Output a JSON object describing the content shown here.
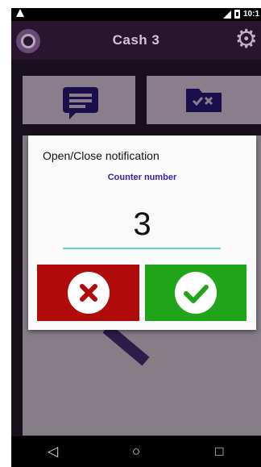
{
  "status_bar": {
    "time": "10:1",
    "left_icon": "alert-triangle-icon",
    "signal_icon": "signal-icon",
    "battery_icon": "battery-icon"
  },
  "header": {
    "title": "Cash 3",
    "logo_icon": "app-logo-icon",
    "settings_icon": "gear-icon"
  },
  "tiles": [
    {
      "icon": "message-icon",
      "color": "#1a0f4a"
    },
    {
      "icon": "folder-check-x-icon",
      "color": "#1a0f4a"
    }
  ],
  "dialog": {
    "title": "Open/Close notification",
    "subtitle": "Counter number",
    "value": "3",
    "cancel_icon": "close-icon",
    "confirm_icon": "check-icon",
    "cancel_color": "#b00a0a",
    "confirm_color": "#20a51a",
    "subtitle_color": "#3c1db1",
    "underline_color": "#61d2d6"
  },
  "navbar": {
    "back_icon": "back-triangle-icon",
    "home_icon": "home-circle-icon",
    "recents_icon": "recents-square-icon",
    "back_glyph": "◁",
    "home_glyph": "○",
    "recents_glyph": "□"
  }
}
